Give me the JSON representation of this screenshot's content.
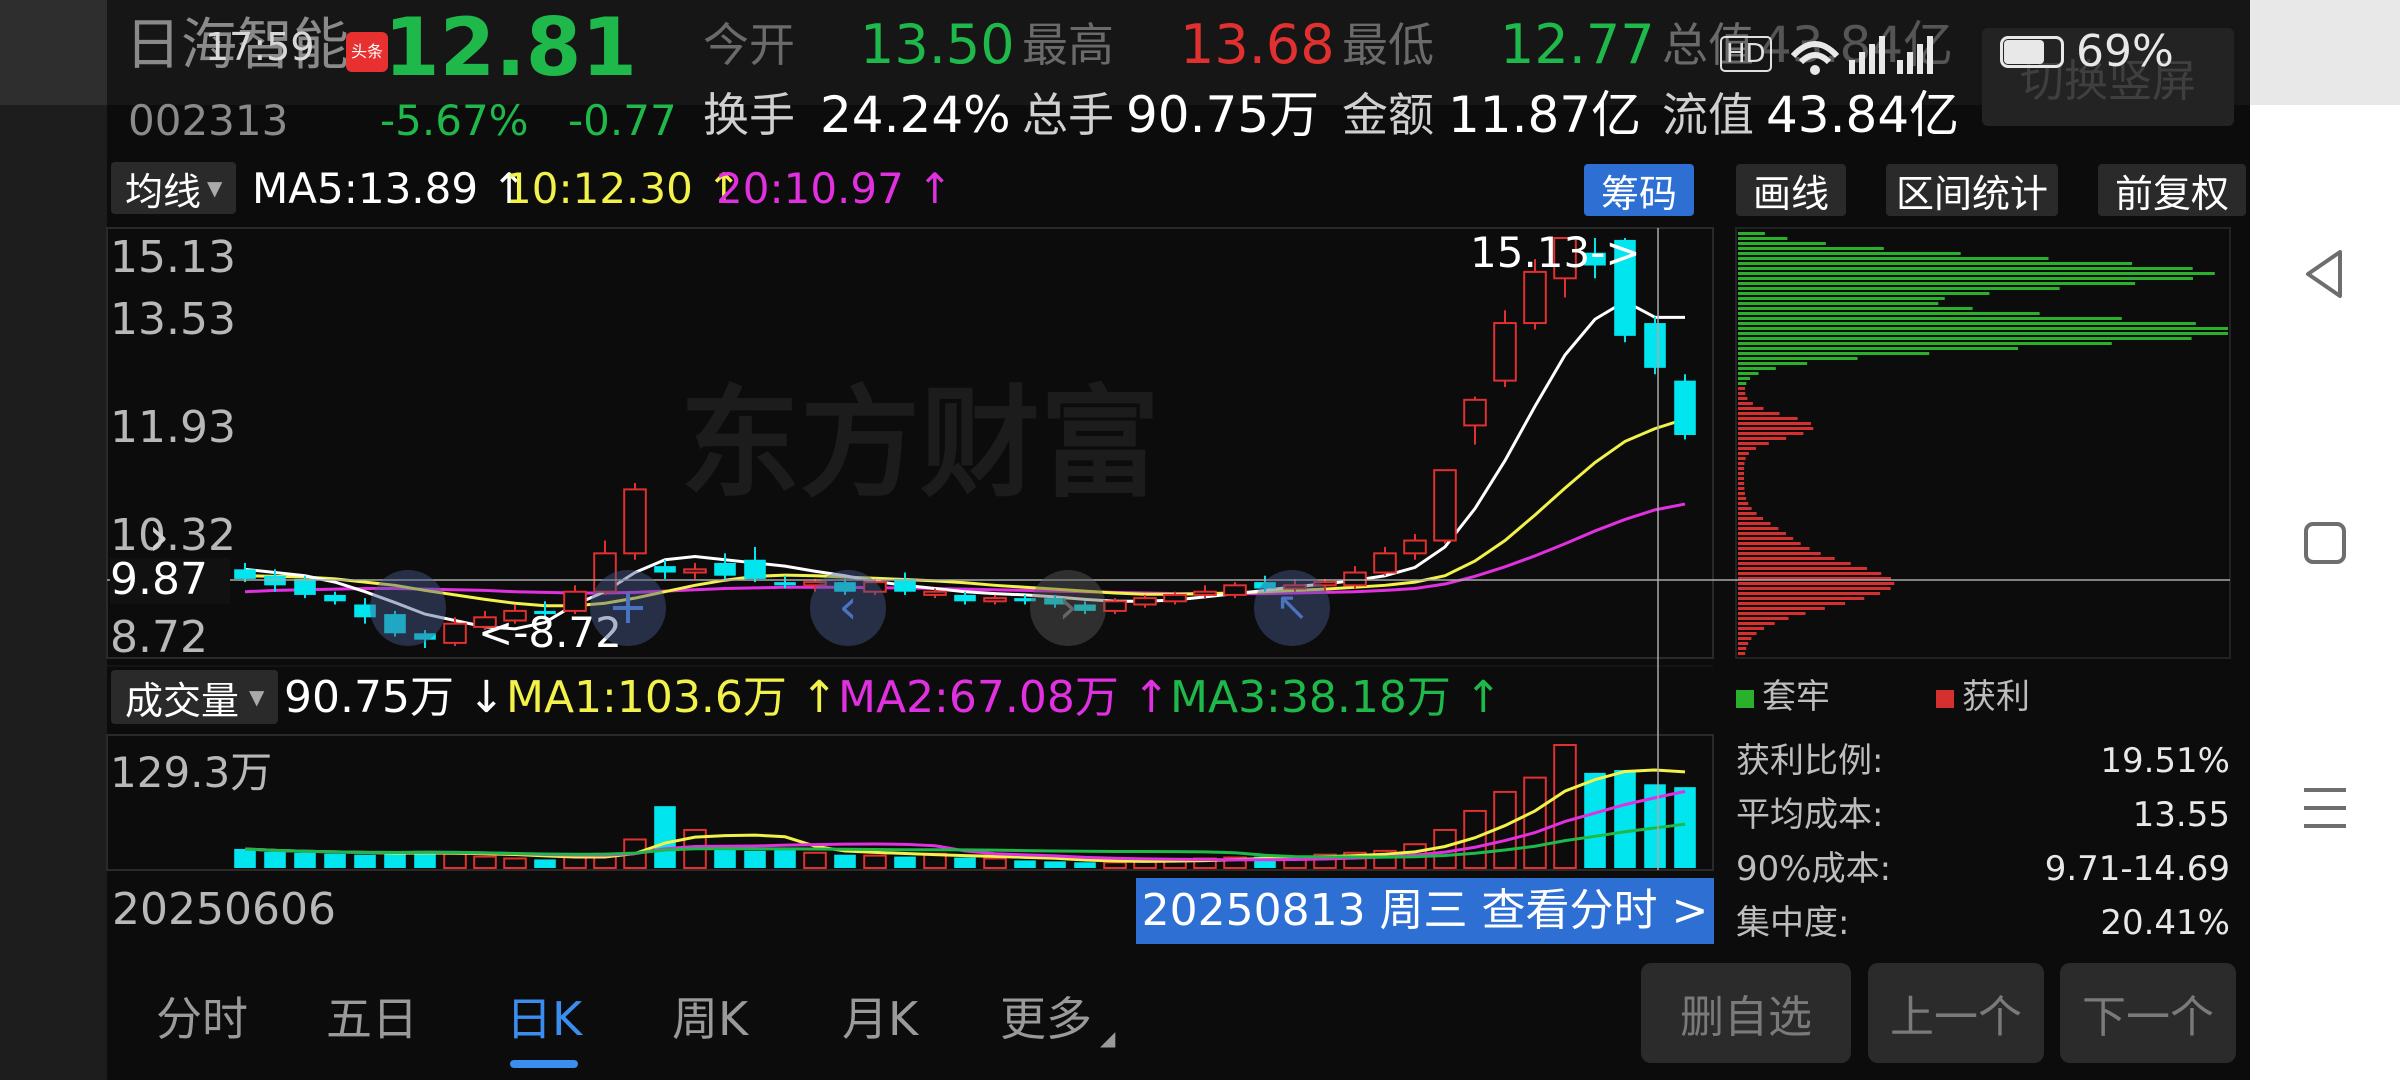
{
  "status_bar": {
    "time": "17:59",
    "app_badge": "头条",
    "battery": "69%",
    "network": "HD 5G 5G"
  },
  "header": {
    "name": "日海智能",
    "code": "002313",
    "price": "12.81",
    "change_pct": "-5.67%",
    "change_amt": "-0.77",
    "open_label": "今开",
    "open": "13.50",
    "high_label": "最高",
    "high": "13.68",
    "low_label": "最低",
    "low": "12.77",
    "total_value_label": "总值",
    "total_value": "43.84亿",
    "turnover_label": "换手",
    "turnover": "24.24%",
    "volume_label": "总手",
    "volume": "90.75万",
    "amount_label": "金额",
    "amount": "11.87亿",
    "float_label": "流值",
    "float_value": "43.84亿",
    "switch_button": "切换竖屏"
  },
  "ma_bar": {
    "selector": "均线",
    "ma5": "MA5:13.89 ↑",
    "ma10": "10:12.30 ↑",
    "ma20": "20:10.97 ↑"
  },
  "top_buttons": {
    "chips": "筹码",
    "draw": "画线",
    "range_stats": "区间统计",
    "adjust": "前复权"
  },
  "price_axis": {
    "max": "15.13",
    "lvl2": "13.53",
    "lvl3": "11.93",
    "lvl4": "10.32",
    "cross": "9.87",
    "min": "8.72"
  },
  "annotations": {
    "high_mark": "15.13->",
    "low_mark": "<-8.72"
  },
  "watermark": "东方财富",
  "volume_bar": {
    "selector": "成交量",
    "value": "90.75万 ↓",
    "ma1": "MA1:103.6万 ↑",
    "ma2": "MA2:67.08万 ↑",
    "ma3": "MA3:38.18万 ↑",
    "axis_max": "129.3万",
    "start_date": "20250606",
    "date_pill": "20250813 周三 查看分时 >"
  },
  "chip_panel": {
    "legend_trapped": "套牢",
    "legend_profit": "获利",
    "rows": [
      {
        "label": "获利比例:",
        "value": "19.51%"
      },
      {
        "label": "平均成本:",
        "value": "13.55"
      },
      {
        "label": "90%成本:",
        "value": "9.71-14.69"
      },
      {
        "label": "集中度:",
        "value": "20.41%"
      }
    ]
  },
  "tabs": [
    "分时",
    "五日",
    "日K",
    "周K",
    "月K",
    "更多"
  ],
  "selected_tab": "日K",
  "bottom_buttons": {
    "remove": "删自选",
    "prev": "上一个",
    "next": "下一个"
  },
  "colors": {
    "up": "#e03030",
    "down": "#00e5ee",
    "ma5": "#ffffff",
    "ma10": "#f2f24a",
    "ma20": "#e030e0",
    "accent": "#2e6fd4"
  },
  "chart_data": {
    "type": "candlestick",
    "period": "daily",
    "start_date": "20250606",
    "end_date": "20250813",
    "ylim": [
      8.72,
      15.13
    ],
    "candles": [
      {
        "o": 9.95,
        "c": 9.8,
        "h": 10.05,
        "l": 9.75
      },
      {
        "o": 9.85,
        "c": 9.7,
        "h": 9.95,
        "l": 9.6
      },
      {
        "o": 9.8,
        "c": 9.55,
        "h": 9.85,
        "l": 9.5
      },
      {
        "o": 9.55,
        "c": 9.45,
        "h": 9.6,
        "l": 9.4
      },
      {
        "o": 9.4,
        "c": 9.2,
        "h": 9.5,
        "l": 9.1
      },
      {
        "o": 9.25,
        "c": 8.95,
        "h": 9.3,
        "l": 8.9
      },
      {
        "o": 8.95,
        "c": 8.85,
        "h": 9.0,
        "l": 8.72
      },
      {
        "o": 8.8,
        "c": 9.1,
        "h": 9.2,
        "l": 8.75
      },
      {
        "o": 9.05,
        "c": 9.2,
        "h": 9.3,
        "l": 9.0
      },
      {
        "o": 9.15,
        "c": 9.3,
        "h": 9.4,
        "l": 9.1
      },
      {
        "o": 9.3,
        "c": 9.25,
        "h": 9.45,
        "l": 9.2
      },
      {
        "o": 9.3,
        "c": 9.6,
        "h": 9.7,
        "l": 9.25
      },
      {
        "o": 9.6,
        "c": 10.2,
        "h": 10.4,
        "l": 9.55
      },
      {
        "o": 10.2,
        "c": 11.2,
        "h": 11.3,
        "l": 10.1
      },
      {
        "o": 10.0,
        "c": 9.9,
        "h": 10.1,
        "l": 9.8
      },
      {
        "o": 9.9,
        "c": 9.95,
        "h": 10.05,
        "l": 9.8
      },
      {
        "o": 10.05,
        "c": 9.85,
        "h": 10.2,
        "l": 9.8
      },
      {
        "o": 10.1,
        "c": 9.8,
        "h": 10.3,
        "l": 9.75
      },
      {
        "o": 9.75,
        "c": 9.7,
        "h": 9.85,
        "l": 9.65
      },
      {
        "o": 9.7,
        "c": 9.75,
        "h": 9.8,
        "l": 9.6
      },
      {
        "o": 9.75,
        "c": 9.6,
        "h": 9.8,
        "l": 9.55
      },
      {
        "o": 9.6,
        "c": 9.75,
        "h": 9.8,
        "l": 9.55
      },
      {
        "o": 9.8,
        "c": 9.6,
        "h": 9.9,
        "l": 9.55
      },
      {
        "o": 9.55,
        "c": 9.6,
        "h": 9.65,
        "l": 9.5
      },
      {
        "o": 9.55,
        "c": 9.45,
        "h": 9.6,
        "l": 9.4
      },
      {
        "o": 9.45,
        "c": 9.5,
        "h": 9.55,
        "l": 9.4
      },
      {
        "o": 9.5,
        "c": 9.45,
        "h": 9.55,
        "l": 9.4
      },
      {
        "o": 9.5,
        "c": 9.4,
        "h": 9.55,
        "l": 9.35
      },
      {
        "o": 9.4,
        "c": 9.3,
        "h": 9.45,
        "l": 9.25
      },
      {
        "o": 9.3,
        "c": 9.45,
        "h": 9.5,
        "l": 9.25
      },
      {
        "o": 9.4,
        "c": 9.5,
        "h": 9.55,
        "l": 9.35
      },
      {
        "o": 9.45,
        "c": 9.55,
        "h": 9.6,
        "l": 9.4
      },
      {
        "o": 9.55,
        "c": 9.6,
        "h": 9.7,
        "l": 9.5
      },
      {
        "o": 9.55,
        "c": 9.7,
        "h": 9.75,
        "l": 9.5
      },
      {
        "o": 9.75,
        "c": 9.65,
        "h": 9.85,
        "l": 9.6
      },
      {
        "o": 9.65,
        "c": 9.7,
        "h": 9.8,
        "l": 9.6
      },
      {
        "o": 9.7,
        "c": 9.75,
        "h": 9.8,
        "l": 9.6
      },
      {
        "o": 9.7,
        "c": 9.9,
        "h": 10.0,
        "l": 9.65
      },
      {
        "o": 9.9,
        "c": 10.2,
        "h": 10.3,
        "l": 9.85
      },
      {
        "o": 10.2,
        "c": 10.4,
        "h": 10.5,
        "l": 10.1
      },
      {
        "o": 10.4,
        "c": 11.5,
        "h": 11.5,
        "l": 10.35
      },
      {
        "o": 12.2,
        "c": 12.6,
        "h": 12.65,
        "l": 11.9
      },
      {
        "o": 12.9,
        "c": 13.8,
        "h": 14.0,
        "l": 12.8
      },
      {
        "o": 13.8,
        "c": 14.6,
        "h": 14.8,
        "l": 13.7
      },
      {
        "o": 14.5,
        "c": 15.13,
        "h": 15.13,
        "l": 14.2
      },
      {
        "o": 14.9,
        "c": 14.7,
        "h": 15.13,
        "l": 14.5
      },
      {
        "o": 15.1,
        "c": 13.6,
        "h": 15.13,
        "l": 13.5
      },
      {
        "o": 13.8,
        "c": 13.1,
        "h": 13.9,
        "l": 13.0
      },
      {
        "o": 12.9,
        "c": 12.05,
        "h": 13.0,
        "l": 11.98
      }
    ],
    "volume_ylim": [
      0,
      129.3
    ],
    "volumes_wan": [
      20,
      17,
      16,
      15,
      14,
      16,
      18,
      15,
      12,
      10,
      9,
      12,
      15,
      30,
      65,
      40,
      20,
      18,
      21,
      16,
      14,
      13,
      12,
      15,
      11,
      10,
      8,
      7,
      6,
      6,
      8,
      9,
      10,
      11,
      12,
      12,
      14,
      16,
      18,
      25,
      40,
      60,
      80,
      95,
      129.3,
      100,
      103,
      88,
      85
    ],
    "ma5": [
      9.95,
      9.9,
      9.85,
      9.75,
      9.6,
      9.43,
      9.25,
      9.15,
      9.05,
      9.02,
      9.12,
      9.4,
      9.6,
      9.9,
      10.1,
      10.15,
      10.1,
      10.05,
      10.0,
      9.92,
      9.85,
      9.76,
      9.7,
      9.65,
      9.6,
      9.57,
      9.55,
      9.52,
      9.48,
      9.45,
      9.45,
      9.47,
      9.52,
      9.57,
      9.62,
      9.68,
      9.72,
      9.78,
      9.85,
      9.98,
      10.3,
      10.9,
      11.65,
      12.5,
      13.3,
      13.86,
      14.14,
      13.89,
      13.89
    ],
    "ma10": [
      9.85,
      9.84,
      9.83,
      9.8,
      9.75,
      9.7,
      9.62,
      9.55,
      9.48,
      9.42,
      9.38,
      9.38,
      9.42,
      9.5,
      9.6,
      9.7,
      9.78,
      9.84,
      9.86,
      9.85,
      9.83,
      9.81,
      9.79,
      9.77,
      9.74,
      9.7,
      9.67,
      9.64,
      9.61,
      9.58,
      9.56,
      9.56,
      9.57,
      9.58,
      9.6,
      9.62,
      9.64,
      9.67,
      9.7,
      9.75,
      9.85,
      10.08,
      10.4,
      10.8,
      11.22,
      11.62,
      11.95,
      12.15,
      12.3
    ],
    "ma20": [
      9.6,
      9.62,
      9.63,
      9.64,
      9.65,
      9.65,
      9.64,
      9.63,
      9.62,
      9.6,
      9.59,
      9.58,
      9.58,
      9.59,
      9.61,
      9.63,
      9.65,
      9.66,
      9.67,
      9.67,
      9.67,
      9.66,
      9.66,
      9.65,
      9.64,
      9.63,
      9.62,
      9.61,
      9.6,
      9.59,
      9.58,
      9.57,
      9.57,
      9.57,
      9.57,
      9.58,
      9.59,
      9.6,
      9.62,
      9.65,
      9.72,
      9.84,
      9.99,
      10.16,
      10.35,
      10.55,
      10.73,
      10.88,
      10.97
    ]
  }
}
